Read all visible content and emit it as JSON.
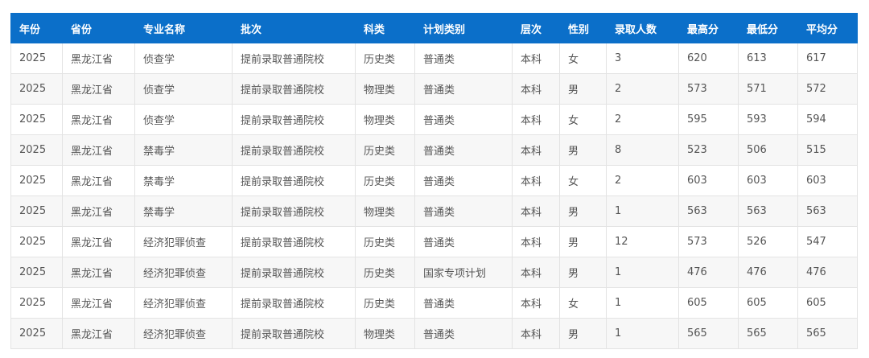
{
  "table": {
    "headers": [
      "年份",
      "省份",
      "专业名称",
      "批次",
      "科类",
      "计划类别",
      "层次",
      "性别",
      "录取人数",
      "最高分",
      "最低分",
      "平均分"
    ],
    "rows": [
      [
        "2025",
        "黑龙江省",
        "侦查学",
        "提前录取普通院校",
        "历史类",
        "普通类",
        "本科",
        "女",
        "3",
        "620",
        "613",
        "617"
      ],
      [
        "2025",
        "黑龙江省",
        "侦查学",
        "提前录取普通院校",
        "物理类",
        "普通类",
        "本科",
        "男",
        "2",
        "573",
        "571",
        "572"
      ],
      [
        "2025",
        "黑龙江省",
        "侦查学",
        "提前录取普通院校",
        "物理类",
        "普通类",
        "本科",
        "女",
        "2",
        "595",
        "593",
        "594"
      ],
      [
        "2025",
        "黑龙江省",
        "禁毒学",
        "提前录取普通院校",
        "历史类",
        "普通类",
        "本科",
        "男",
        "8",
        "523",
        "506",
        "515"
      ],
      [
        "2025",
        "黑龙江省",
        "禁毒学",
        "提前录取普通院校",
        "历史类",
        "普通类",
        "本科",
        "女",
        "2",
        "603",
        "603",
        "603"
      ],
      [
        "2025",
        "黑龙江省",
        "禁毒学",
        "提前录取普通院校",
        "物理类",
        "普通类",
        "本科",
        "男",
        "1",
        "563",
        "563",
        "563"
      ],
      [
        "2025",
        "黑龙江省",
        "经济犯罪侦查",
        "提前录取普通院校",
        "历史类",
        "普通类",
        "本科",
        "男",
        "12",
        "573",
        "526",
        "547"
      ],
      [
        "2025",
        "黑龙江省",
        "经济犯罪侦查",
        "提前录取普通院校",
        "历史类",
        "国家专项计划",
        "本科",
        "男",
        "1",
        "476",
        "476",
        "476"
      ],
      [
        "2025",
        "黑龙江省",
        "经济犯罪侦查",
        "提前录取普通院校",
        "历史类",
        "普通类",
        "本科",
        "女",
        "1",
        "605",
        "605",
        "605"
      ],
      [
        "2025",
        "黑龙江省",
        "经济犯罪侦查",
        "提前录取普通院校",
        "物理类",
        "普通类",
        "本科",
        "男",
        "1",
        "565",
        "565",
        "565"
      ]
    ]
  },
  "colors": {
    "header_bg": "#0b6fc9",
    "header_text": "#ffffff",
    "row_alt_bg": "#f7f7f7",
    "border": "#e3e3e3"
  }
}
